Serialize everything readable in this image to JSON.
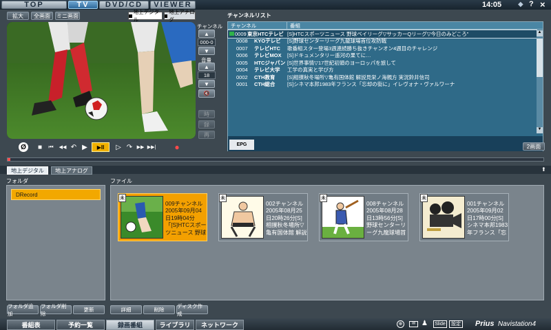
{
  "top_tabs": [
    {
      "label": "TOP"
    },
    {
      "label": "TV"
    },
    {
      "label": "DVD/CD"
    },
    {
      "label": "VIEWER"
    }
  ],
  "clock": "14:05",
  "window_controls": {
    "minimize": "◆",
    "help": "?",
    "close": "×"
  },
  "view_buttons": {
    "enlarge": "拡大",
    "fullscreen": "全画面",
    "mini": "ミニ画面"
  },
  "source_toggle": {
    "digital": "地上デジタル",
    "analog": "地上アナログ"
  },
  "channel_panel": {
    "channel_label": "チャンネル",
    "channel_value": "000-0",
    "volume_label": "音量",
    "volume_value": "18",
    "mute": "🔇"
  },
  "side_buttons": [
    "時",
    "録",
    "再"
  ],
  "channel_list": {
    "title": "チャンネルリスト",
    "headers": {
      "channel": "チャンネル",
      "program": "番組"
    },
    "rows": [
      {
        "num": "0009",
        "station": "東京HTCテレビ",
        "program": "[S]HTCスポーツニュース 野球ベイリーグ▽サッカーQリーグ▽今日のみどころ”"
      },
      {
        "num": "0008",
        "station": "KYOテレビ",
        "program": "[S]野球センターリーグ九龍球場首位攻防戦"
      },
      {
        "num": "0007",
        "station": "テレビHTC",
        "program": "歌番組スター登場3週連続勝ち抜きチャンオン4週目のチャレンジ"
      },
      {
        "num": "0006",
        "station": "テレビMOX",
        "program": "[S]ドキュメンタリー遥河の果てに…"
      },
      {
        "num": "0005",
        "station": "HTCジャパン",
        "program": "[S]世界事情▽17世紀初頭のヨーロッパを旅して"
      },
      {
        "num": "0004",
        "station": "テレビ大学",
        "program": "工学の真実と学び方"
      },
      {
        "num": "0002",
        "station": "CTH教育",
        "program": "[S]相撲秋冬場所▽亀有国体館 解説見栄ノ海親方 実況鈴井信司"
      },
      {
        "num": "0001",
        "station": "CTH総合",
        "program": "[S]シネマ本邦1983年フランス「忘却の街に」イレヴォナ・ヴァルワーナ"
      }
    ],
    "epg_icon": "EPG",
    "dual_screen": "2画面"
  },
  "playback_controls": [
    "Ø",
    "■",
    "⏮",
    "◀◀",
    "↶",
    "▶",
    "▶ll",
    "▷",
    "↷",
    "▶▶",
    "▶▶|",
    "●"
  ],
  "lower_tabs": [
    {
      "label": "地上デジタル"
    },
    {
      "label": "地上アナログ"
    }
  ],
  "folder_panel": {
    "title": "フォルダ",
    "items": [
      "DRecord"
    ]
  },
  "file_panel": {
    "title": "ファイル",
    "files": [
      {
        "badge": "未",
        "text": "009チャンネル2005年09月04日19時04分「[S]HTCスポーツニュース 野球ベ"
      },
      {
        "badge": "未",
        "text": "002チャンネル2005年08月25日20時26分[S]相撲秋冬場所▽亀有国体館 解説見栄"
      },
      {
        "badge": "未",
        "text": "008チャンネル2005年08月28日13時56分[S]野球センターリーグ九龍球場首位攻防"
      },
      {
        "badge": "未",
        "text": "001チャンネル2005年09月02日17時00分[S]シネマ本邦1983年フランス「忘却の"
      }
    ]
  },
  "folder_buttons": {
    "add": "フォルダ追加",
    "delete": "フォルダ削除",
    "update": "更新"
  },
  "file_buttons": {
    "detail": "詳細",
    "delete": "削除",
    "disc": "ディスク作成"
  },
  "footer_tabs": [
    {
      "label": "番組表"
    },
    {
      "label": "予約一覧"
    },
    {
      "label": "録画番組"
    },
    {
      "label": "ライブラリ"
    },
    {
      "label": "ネットワーク"
    }
  ],
  "footer_icons": {
    "slide": "Slide",
    "settings": "設定"
  },
  "brand": {
    "prius": "Prius",
    "navi": "Navistation4"
  }
}
